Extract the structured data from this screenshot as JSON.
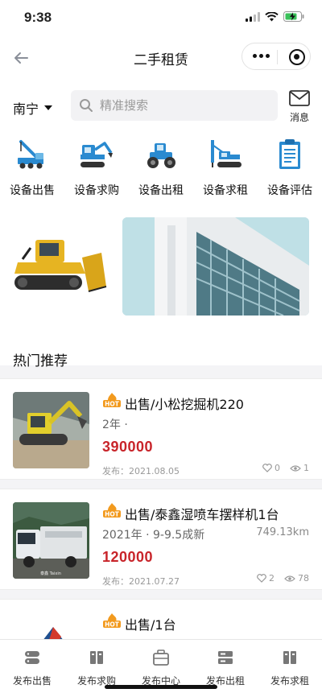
{
  "status": {
    "time": "9:38"
  },
  "nav": {
    "title": "二手租赁"
  },
  "header": {
    "city": "南宁",
    "search_placeholder": "精准搜索",
    "message_label": "消息"
  },
  "categories": [
    {
      "label": "设备出售",
      "icon": "crane-truck-icon"
    },
    {
      "label": "设备求购",
      "icon": "excavator-icon"
    },
    {
      "label": "设备出租",
      "icon": "roller-tractor-icon"
    },
    {
      "label": "设备求租",
      "icon": "drill-rig-icon"
    },
    {
      "label": "设备评估",
      "icon": "clipboard-icon"
    }
  ],
  "section_title": "热门推荐",
  "listings": [
    {
      "title": "出售/小松挖掘机220",
      "subtitle": "2年 ·",
      "distance": "",
      "price": "390000",
      "date": "发布：2021.08.05",
      "likes": "0",
      "views": "1"
    },
    {
      "title": "出售/泰鑫湿喷车摆样机1台",
      "subtitle": "2021年 · 9-9.5成新",
      "distance": "749.13km",
      "price": "120000",
      "date": "发布：2021.07.27",
      "likes": "2",
      "views": "78"
    },
    {
      "title": "出售/1台",
      "subtitle": "",
      "distance": "",
      "price": "",
      "date": "",
      "likes": "",
      "views": ""
    }
  ],
  "tabs": [
    {
      "label": "发布出售",
      "icon": "stack-icon"
    },
    {
      "label": "发布求购",
      "icon": "books-icon"
    },
    {
      "label": "发布中心",
      "icon": "toolbox-icon"
    },
    {
      "label": "发布出租",
      "icon": "server-icon"
    },
    {
      "label": "发布求租",
      "icon": "books-icon"
    }
  ],
  "colors": {
    "accent": "#c8242a",
    "hot": "#f29a1e",
    "machine": "#2a8ad0"
  }
}
